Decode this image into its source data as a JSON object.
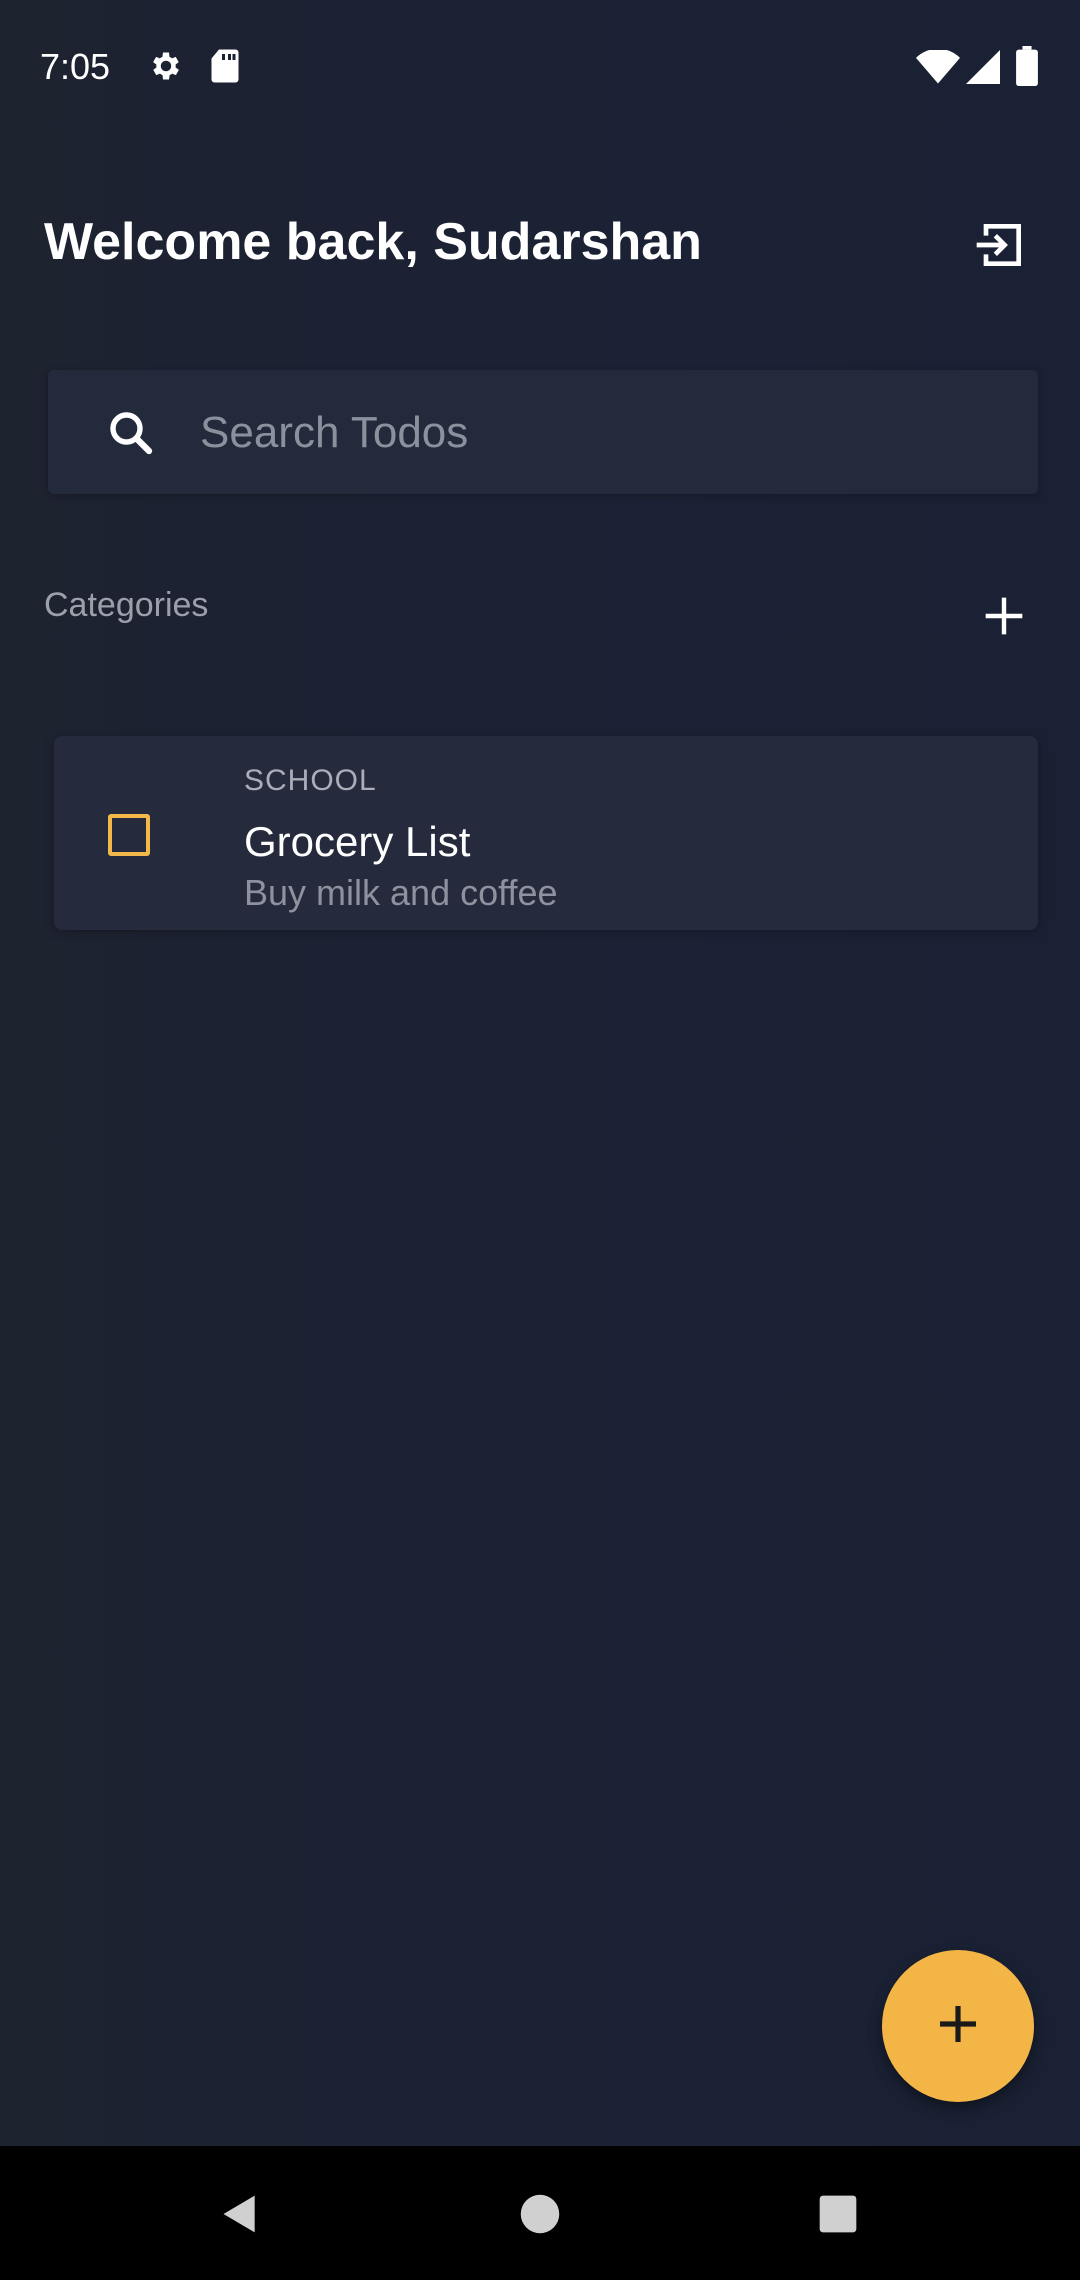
{
  "status_bar": {
    "time": "7:05",
    "icons": [
      "settings-icon",
      "sd-card-icon",
      "wifi-icon",
      "signal-icon",
      "battery-icon"
    ]
  },
  "header": {
    "greeting": "Welcome back, Sudarshan",
    "logout_icon": "logout-icon"
  },
  "search": {
    "placeholder": "Search Todos",
    "value": "",
    "icon": "search-icon"
  },
  "categories": {
    "label": "Categories",
    "add_icon": "plus-icon"
  },
  "todos": [
    {
      "category": "SCHOOL",
      "title": "Grocery List",
      "description": "Buy milk and coffee",
      "checked": false
    }
  ],
  "fab": {
    "icon": "plus-icon"
  },
  "navigation": {
    "buttons": [
      "back-icon",
      "home-icon",
      "recents-icon"
    ]
  },
  "colors": {
    "background": "#1b2030",
    "card": "#252b3c",
    "accent": "#f4b547",
    "text_primary": "#ffffff",
    "text_secondary": "#9ca0ab"
  }
}
